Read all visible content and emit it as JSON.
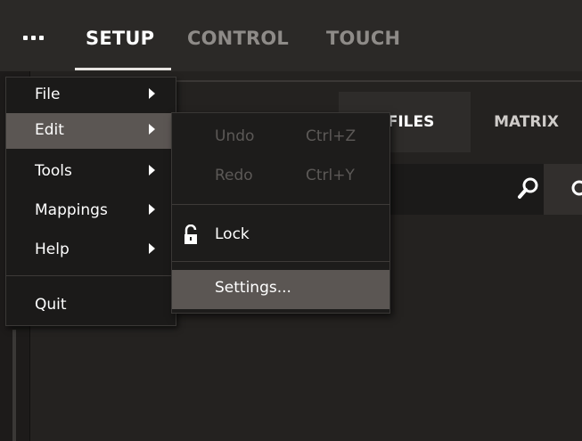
{
  "topbar": {
    "menu_icon": "more-dots-icon",
    "tabs": [
      {
        "label": "SETUP",
        "active": true
      },
      {
        "label": "CONTROL",
        "active": false
      },
      {
        "label": "TOUCH",
        "active": false
      }
    ]
  },
  "panel": {
    "subtabs": [
      {
        "label": "PROFILES",
        "visible_text": "DFILES",
        "active": true
      },
      {
        "label": "MATRIX",
        "active": false
      }
    ],
    "search": {
      "value": "",
      "placeholder": ""
    },
    "icons": [
      "search-icon"
    ]
  },
  "main_menu": {
    "items": [
      {
        "label": "File",
        "has_submenu": true,
        "highlighted": false
      },
      {
        "label": "Edit",
        "has_submenu": true,
        "highlighted": true
      },
      {
        "label": "Tools",
        "has_submenu": true,
        "highlighted": false
      },
      {
        "label": "Mappings",
        "has_submenu": true,
        "highlighted": false
      },
      {
        "label": "Help",
        "has_submenu": true,
        "highlighted": false
      },
      {
        "label": "Quit",
        "has_submenu": false,
        "highlighted": false
      }
    ]
  },
  "edit_submenu": {
    "items": [
      {
        "label": "Undo",
        "shortcut": "Ctrl+Z",
        "enabled": false
      },
      {
        "label": "Redo",
        "shortcut": "Ctrl+Y",
        "enabled": false
      },
      {
        "label": "Lock",
        "icon": "unlock-icon",
        "enabled": true
      },
      {
        "label": "Settings...",
        "enabled": true,
        "highlighted": true
      }
    ]
  },
  "colors": {
    "background": "#201e1c",
    "topbar": "#2b2927",
    "menu": "#1b1a19",
    "highlight": "#5b5653",
    "active_text": "#ffffff",
    "inactive_tab": "#8e8b88",
    "disabled_text": "#5c5957"
  }
}
